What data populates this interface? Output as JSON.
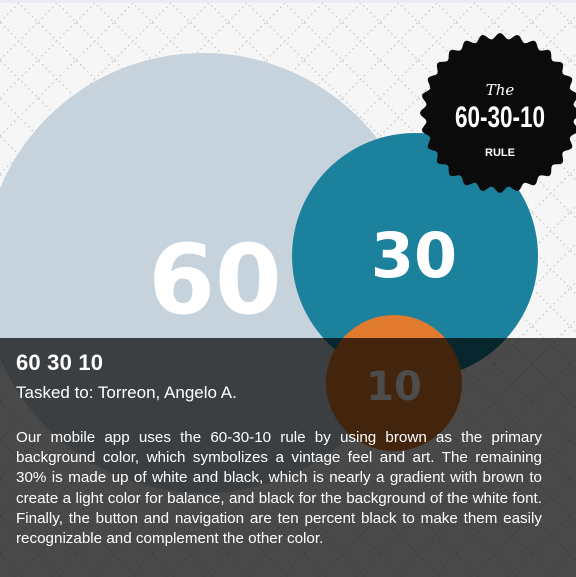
{
  "graphic": {
    "value_60": "60",
    "value_30": "30",
    "value_10": "10",
    "badge_the": "The",
    "badge_main": "60-30-10",
    "badge_rule": "RULE",
    "colors": {
      "circle_60": "#c7d3dc",
      "circle_30": "#1c819c",
      "circle_10": "#e07a2e",
      "badge": "#0b0b0b",
      "background": "#f6f6f6",
      "pattern_dots": "#c9c9c9"
    }
  },
  "card": {
    "title": "60 30 10",
    "assignee": "Tasked to: Torreon, Angelo A.",
    "description": "Our mobile app uses the 60-30-10 rule by using brown as the primary background color, which symbolizes a vintage feel and art. The remaining 30% is made up of white and black, which is nearly a gradient with brown to create a light color for balance, and black for the background of the white font. Finally, the button and navigation are ten percent black to make them easily recognizable and complement the other color.",
    "overlay_color": "#000000b3"
  }
}
